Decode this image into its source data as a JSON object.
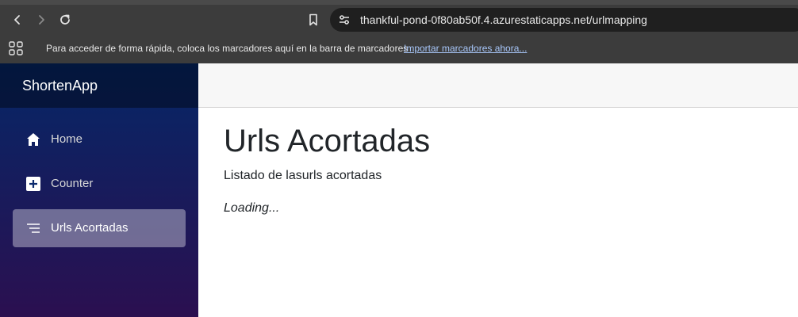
{
  "browser": {
    "url": "thankful-pond-0f80ab50f.4.azurestaticapps.net/urlmapping",
    "bookmarks_prompt": "Para acceder de forma rápida, coloca los marcadores aquí en la barra de marcadores",
    "bookmarks_import_link": "Importar marcadores ahora...",
    "icons": [
      "back-icon",
      "forward-icon",
      "reload-icon",
      "bookmark-icon",
      "site-info-icon",
      "apps-grid-icon"
    ]
  },
  "app": {
    "brand": "ShortenApp",
    "nav": [
      {
        "label": "Home",
        "icon": "home-icon",
        "active": false
      },
      {
        "label": "Counter",
        "icon": "plus-square-icon",
        "active": false
      },
      {
        "label": "Urls Acortadas",
        "icon": "list-icon",
        "active": true
      }
    ],
    "colors": {
      "sidebar_top": "#052767",
      "sidebar_bottom": "#3a0647",
      "active_item": "rgba(255,255,255,0.37)"
    }
  },
  "page": {
    "title": "Urls Acortadas",
    "subtitle": "Listado de lasurls acortadas",
    "status": "Loading..."
  }
}
